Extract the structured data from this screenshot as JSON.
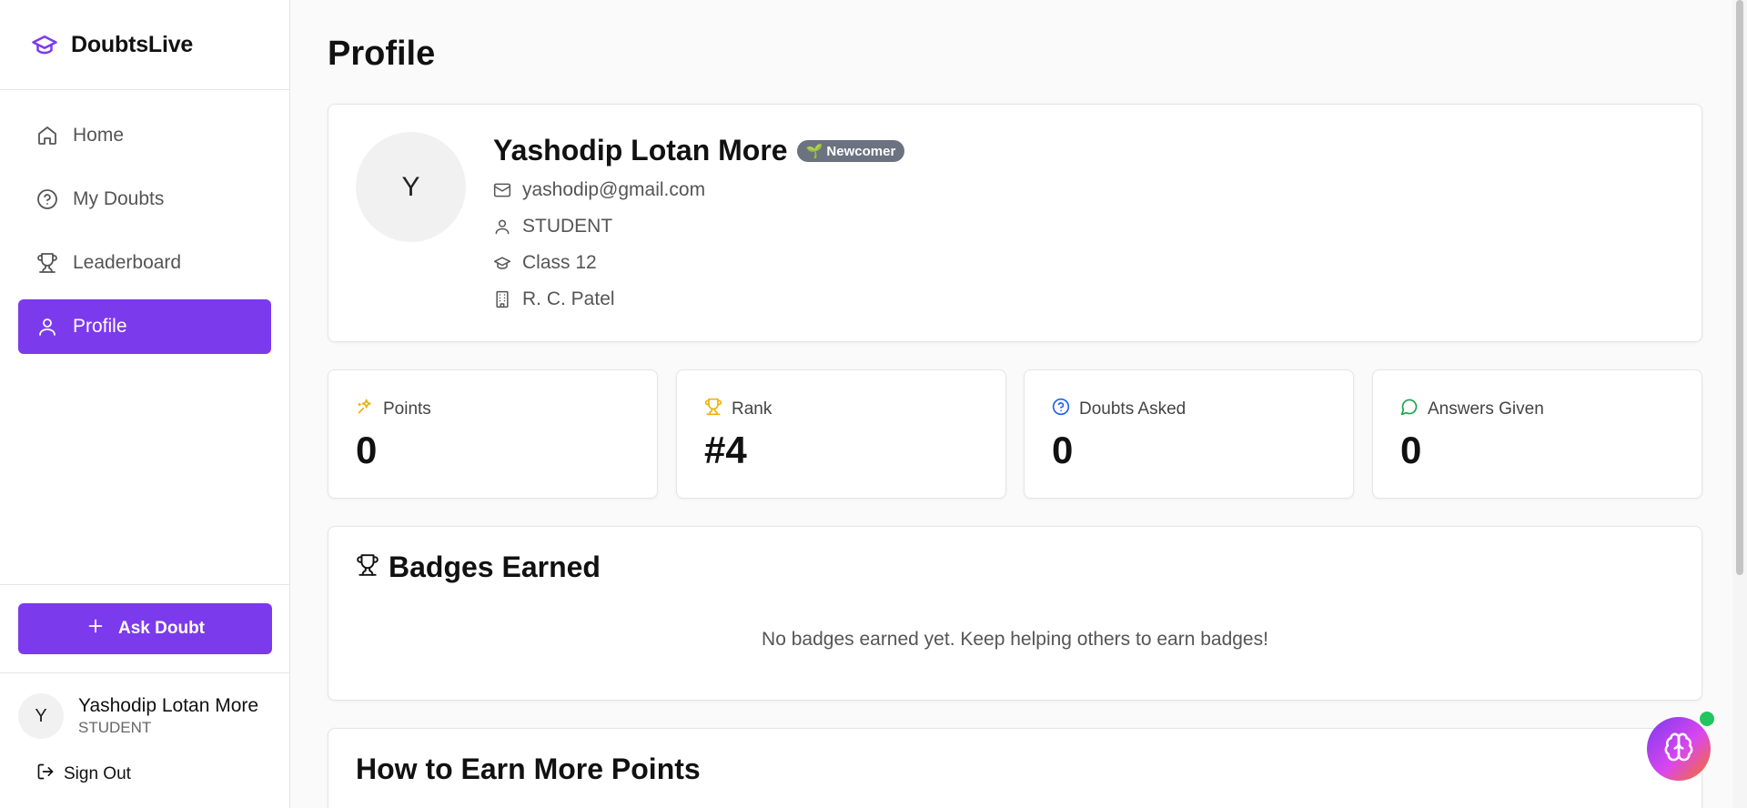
{
  "app": {
    "name": "DoubtsLive"
  },
  "nav": {
    "items": [
      {
        "label": "Home",
        "icon": "home-icon"
      },
      {
        "label": "My Doubts",
        "icon": "help-circle-icon"
      },
      {
        "label": "Leaderboard",
        "icon": "trophy-icon"
      },
      {
        "label": "Profile",
        "icon": "user-icon",
        "active": true
      }
    ]
  },
  "sidebar": {
    "ask_label": "Ask Doubt",
    "user": {
      "initial": "Y",
      "name": "Yashodip Lotan More",
      "role": "STUDENT"
    },
    "signout_label": "Sign Out"
  },
  "page": {
    "title": "Profile"
  },
  "profile": {
    "initial": "Y",
    "name": "Yashodip Lotan More",
    "badge": "🌱 Newcomer",
    "email": "yashodip@gmail.com",
    "role": "STUDENT",
    "class": "Class 12",
    "school": "R. C. Patel"
  },
  "stats": [
    {
      "label": "Points",
      "value": "0",
      "icon": "sparkles-icon",
      "color": "#eab308"
    },
    {
      "label": "Rank",
      "value": "#4",
      "icon": "trophy-icon",
      "color": "#eab308"
    },
    {
      "label": "Doubts Asked",
      "value": "0",
      "icon": "help-circle-icon",
      "color": "#2563eb"
    },
    {
      "label": "Answers Given",
      "value": "0",
      "icon": "message-circle-icon",
      "color": "#16a34a"
    }
  ],
  "badges": {
    "title": "Badges Earned",
    "empty_message": "No badges earned yet. Keep helping others to earn badges!"
  },
  "earn": {
    "title": "How to Earn More Points"
  },
  "colors": {
    "accent": "#7c3aed",
    "online": "#22c55e"
  }
}
